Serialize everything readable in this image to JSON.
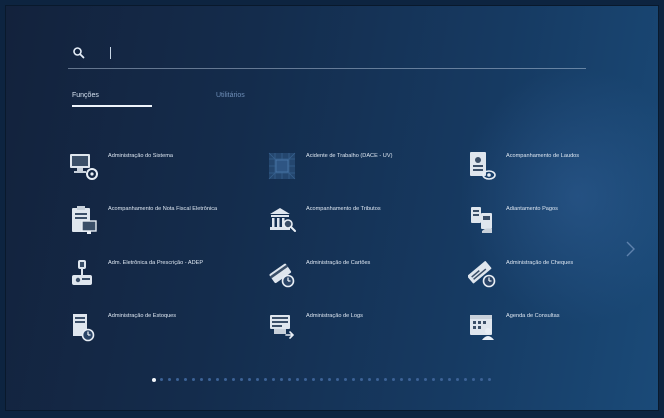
{
  "search": {
    "placeholder": "",
    "value": ""
  },
  "tabs": [
    {
      "label": "Funções",
      "active": true
    },
    {
      "label": "Utilitários",
      "active": false
    }
  ],
  "tiles": [
    {
      "label": "Administração do Sistema",
      "icon": "monitor-gear-icon"
    },
    {
      "label": "Acidente de Trabalho (DACE - UV)",
      "icon": "grid-cube-icon"
    },
    {
      "label": "Acompanhamento de Laudos",
      "icon": "document-eye-icon"
    },
    {
      "label": "Acompanhamento de Nota Fiscal Eletrônica",
      "icon": "clipboard-monitor-icon"
    },
    {
      "label": "Acompanhamento de Tributos",
      "icon": "building-search-icon"
    },
    {
      "label": "Adiantamento Pagos",
      "icon": "hand-card-icon"
    },
    {
      "label": "Adm. Eletrônica da Prescrição - ADEP",
      "icon": "prescription-icon"
    },
    {
      "label": "Administração de Cartões",
      "icon": "cards-clock-icon"
    },
    {
      "label": "Administração de Cheques",
      "icon": "checks-clock-icon"
    },
    {
      "label": "Administração de Estoques",
      "icon": "box-clock-icon"
    },
    {
      "label": "Administração de Logs",
      "icon": "logs-monitor-icon"
    },
    {
      "label": "Agenda de Consultas",
      "icon": "calendar-people-icon"
    }
  ],
  "pager": {
    "total": 43,
    "active_index": 0
  },
  "colors": {
    "accent": "#eef4fb",
    "tab_inactive": "#6f8fb8",
    "dot": "#3c6296"
  }
}
